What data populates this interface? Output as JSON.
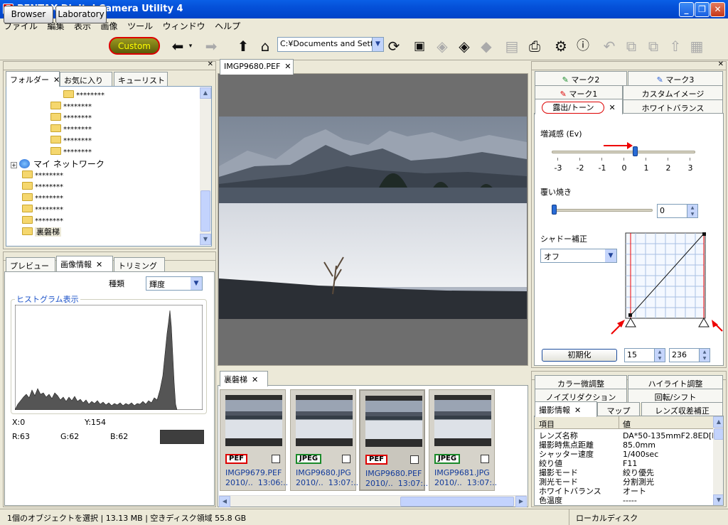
{
  "window": {
    "title": "PENTAX Digital Camera Utility 4",
    "app_icon": "camera-icon",
    "controls": [
      "minimize-icon",
      "maximize-icon",
      "close-icon"
    ]
  },
  "menu": [
    "ファイル",
    "編集",
    "表示",
    "画像",
    "ツール",
    "ウィンドウ",
    "ヘルプ"
  ],
  "toolbar": {
    "modes": [
      "Browser",
      "Laboratory",
      "Custom"
    ],
    "path": "C:¥Documents and Settir",
    "icons": [
      "back-arrow-icon",
      "dropdown-arrow-icon",
      "forward-arrow-icon",
      "up-arrow-icon",
      "home-icon",
      "refresh-icon",
      "save-icon",
      "rotate-left-icon",
      "rotate-right-icon",
      "diamond-icon",
      "monitor-icon",
      "printer-icon",
      "settings-gear-icon",
      "help-icon",
      "undo-icon",
      "copy-icon",
      "paste-icon",
      "export-icon",
      "delete-icon"
    ]
  },
  "folder_panel": {
    "tabs": [
      "フォルダー",
      "お気に入り",
      "キューリスト"
    ],
    "items": [
      "********",
      "********",
      "********",
      "********",
      "********",
      "********"
    ],
    "network_label": "マイ ネットワーク",
    "sub_items": [
      "********",
      "********",
      "********",
      "********",
      "********"
    ],
    "selected": "裏磐梯"
  },
  "info_panel": {
    "tabs": [
      "プレビュー",
      "画像情報",
      "トリミング"
    ],
    "type_label": "種類",
    "type_value": "輝度",
    "histogram_title": "ヒストグラム表示",
    "x": "X:0",
    "y": "Y:154",
    "r": "R:63",
    "g": "G:62",
    "b": "B:62",
    "swatch_color": "#3e3e3e"
  },
  "viewer": {
    "tab_label": "IMGP9680.PEF"
  },
  "thumbs_panel": {
    "tab_label": "裏磐梯",
    "items": [
      {
        "badge": "PEF",
        "name": "IMGP9679.PEF",
        "date": "2010/..",
        "time": "13:06:..",
        "selected": false
      },
      {
        "badge": "JPEG",
        "name": "IMGP9680.JPG",
        "date": "2010/..",
        "time": "13:07:..",
        "selected": false
      },
      {
        "badge": "PEF",
        "name": "IMGP9680.PEF",
        "date": "2010/..",
        "time": "13:07:..",
        "selected": true
      },
      {
        "badge": "JPEG",
        "name": "IMGP9681.JPG",
        "date": "2010/..",
        "time": "13:07:..",
        "selected": false
      }
    ]
  },
  "adjust_panel": {
    "tabs_row1": [
      "マーク2",
      "マーク3"
    ],
    "tabs_row2": [
      "マーク1",
      "カスタムイメージ"
    ],
    "tabs_row3": [
      "露出/トーン",
      "ホワイトバランス"
    ],
    "exposure_label": "増減感 (Ev)",
    "exposure_ticks": [
      "-3",
      "-2",
      "-1",
      "0",
      "1",
      "2",
      "3"
    ],
    "exposure_value_ev": 0.5,
    "dodge_label": "覆い焼き",
    "dodge_value": "0",
    "shadow_label": "シャドー補正",
    "shadow_value": "オフ",
    "reset_label": "初期化",
    "low_value": "15",
    "high_value": "236",
    "accent_color": "#e00000"
  },
  "info2_panel": {
    "tabs_row1": [
      "カラー微調整",
      "ハイライト調整"
    ],
    "tabs_row2": [
      "ノイズリダクション",
      "回転/シフト"
    ],
    "tabs_row3": [
      "撮影情報",
      "マップ",
      "レンズ収差補正"
    ],
    "col_item": "項目",
    "col_value": "値",
    "rows": [
      {
        "k": "レンズ名称",
        "v": "DA*50-135mmF2.8ED[I..."
      },
      {
        "k": "撮影時焦点距離",
        "v": "85.0mm"
      },
      {
        "k": "シャッター速度",
        "v": "1/400sec"
      },
      {
        "k": "絞り値",
        "v": "F11"
      },
      {
        "k": "撮影モード",
        "v": "絞り優先"
      },
      {
        "k": "測光モード",
        "v": "分割測光"
      },
      {
        "k": "ホワイトバランス",
        "v": "オート"
      },
      {
        "k": "色温度",
        "v": "-----"
      }
    ]
  },
  "status": {
    "left": "1個のオブジェクトを選択 | 13.13 MB | 空きディスク領域 55.8 GB",
    "right": "ローカルディスク"
  }
}
